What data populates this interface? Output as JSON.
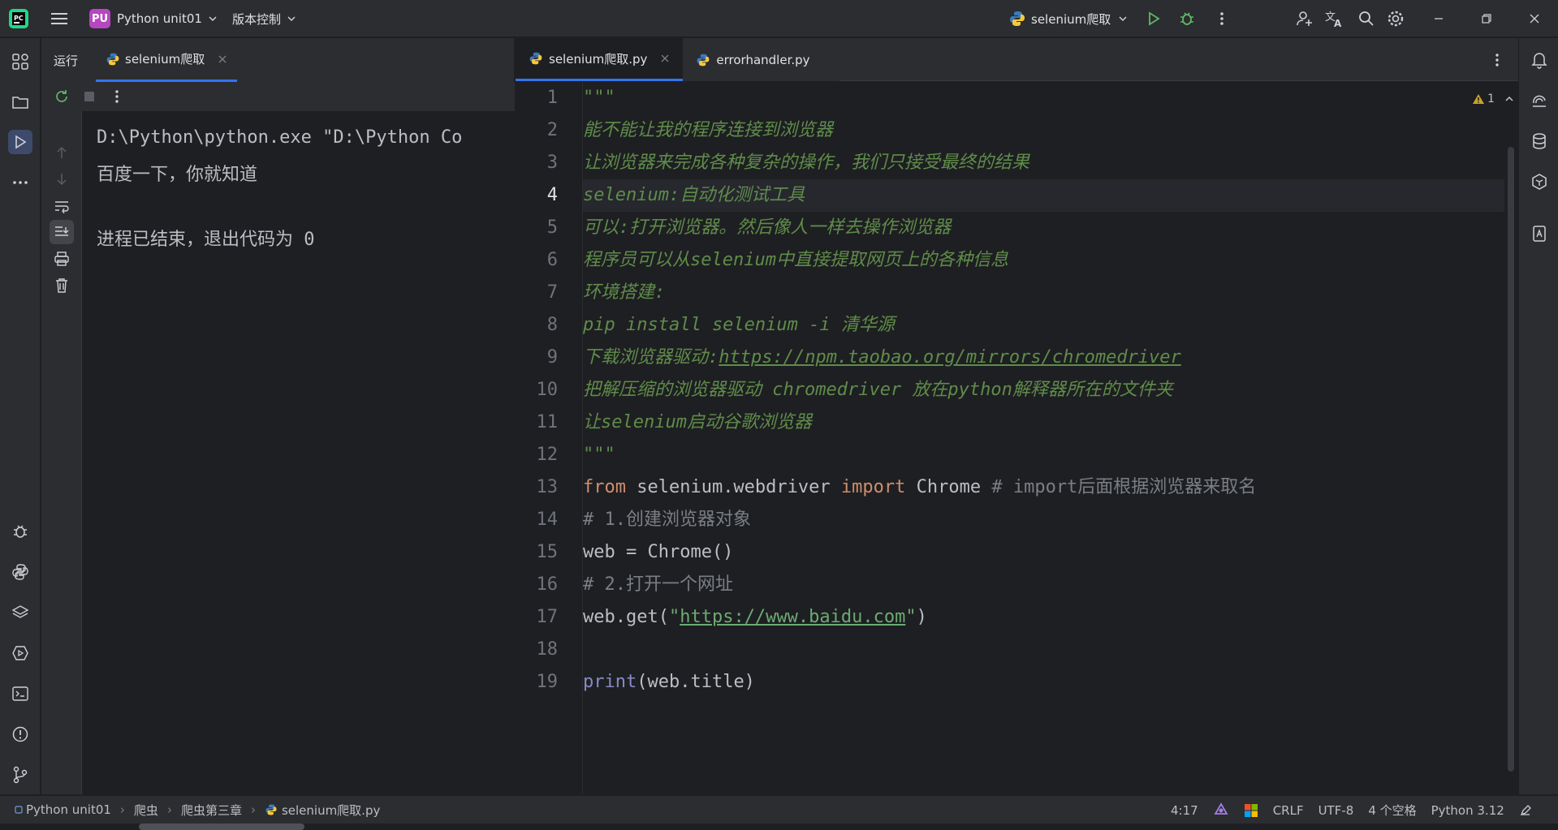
{
  "titlebar": {
    "project_badge": "PU",
    "project_name": "Python unit01",
    "vcs_label": "版本控制",
    "run_config": "selenium爬取"
  },
  "run_panel": {
    "tab_run": "运行",
    "tab_config": "selenium爬取",
    "console_lines": [
      "D:\\Python\\python.exe \"D:\\Python Co",
      "百度一下，你就知道",
      "",
      "进程已结束，退出代码为 0"
    ]
  },
  "editor": {
    "tabs": [
      {
        "label": "selenium爬取.py",
        "active": true
      },
      {
        "label": "errorhandler.py",
        "active": false
      }
    ],
    "warning_count": "1",
    "current_line": 4,
    "line_numbers": [
      "1",
      "2",
      "3",
      "4",
      "5",
      "6",
      "7",
      "8",
      "9",
      "10",
      "11",
      "12",
      "13",
      "14",
      "15",
      "16",
      "17",
      "18",
      "19"
    ],
    "code": {
      "l1": "\"\"\"",
      "l2": "能不能让我的程序连接到浏览器",
      "l3": "让浏览器来完成各种复杂的操作，我们只接受最终的结果",
      "l4": "selenium:自动化测试工具",
      "l5": "可以:打开浏览器。然后像人一样去操作浏览器",
      "l6": "程序员可以从selenium中直接提取网页上的各种信息",
      "l7": "环境搭建:",
      "l8": "pip install selenium -i 清华源",
      "l9_prefix": "下载浏览器驱动:",
      "l9_link": "https://npm.taobao.org/mirrors/chromedriver",
      "l10": "把解压缩的浏览器驱动 chromedriver 放在python解释器所在的文件夹",
      "l11": "让selenium启动谷歌浏览器",
      "l12": "\"\"\"",
      "l13_from": "from",
      "l13_mod": " selenium.webdriver ",
      "l13_import": "import",
      "l13_name": " Chrome ",
      "l13_comment": "# import后面根据浏览器来取名",
      "l14": "# 1.创建浏览器对象",
      "l15": "web = Chrome()",
      "l16": "# 2.打开一个网址",
      "l17_pre": "web.get(",
      "l17_q1": "\"",
      "l17_url": "https://www.baidu.com",
      "l17_q2": "\"",
      "l17_post": ")",
      "l19_print": "print",
      "l19_rest": "(web.title)"
    }
  },
  "statusbar": {
    "breadcrumb": [
      "Python unit01",
      "爬虫",
      "爬虫第三章",
      "selenium爬取.py"
    ],
    "position": "4:17",
    "line_sep": "CRLF",
    "encoding": "UTF-8",
    "indent": "4 个空格",
    "interpreter": "Python 3.12"
  }
}
